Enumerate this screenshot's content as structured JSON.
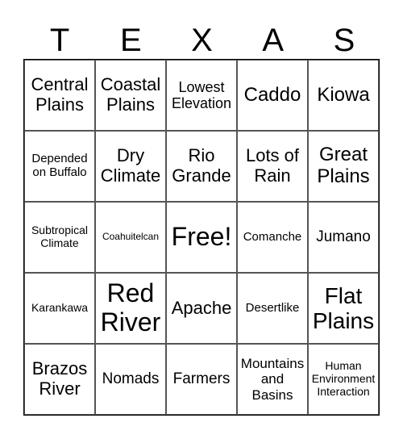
{
  "header": [
    "T",
    "E",
    "X",
    "A",
    "S"
  ],
  "cells": [
    [
      "Central Plains",
      "Coastal Plains",
      "Lowest Elevation",
      "Caddo",
      "Kiowa"
    ],
    [
      "Depended on Buffalo",
      "Dry Climate",
      "Rio Grande",
      "Lots of Rain",
      "Great Plains"
    ],
    [
      "Subtropical Climate",
      "Coahuitelcan",
      "Free!",
      "Comanche",
      "Jumano"
    ],
    [
      "Karankawa",
      "Red River",
      "Apache",
      "Desertlike",
      "Flat Plains"
    ],
    [
      "Brazos River",
      "Nomads",
      "Farmers",
      "Mountains and Basins",
      "Human Environment Interaction"
    ]
  ]
}
